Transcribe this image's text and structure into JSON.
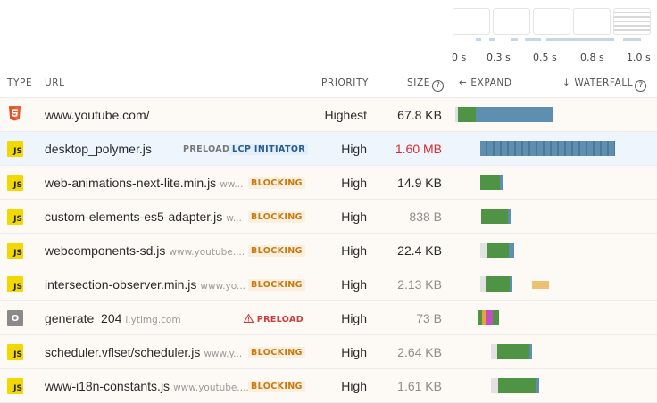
{
  "filmstrip": {
    "ticks": [
      "0 s",
      "0.3 s",
      "0.5 s",
      "0.8 s",
      "1.0 s"
    ]
  },
  "columns": {
    "type": "TYPE",
    "url": "URL",
    "priority": "PRIORITY",
    "size": "SIZE",
    "size_help": "?",
    "expand": "EXPAND",
    "expand_arrow": "←",
    "waterfall": "WATERFALL",
    "waterfall_arrow": "↓",
    "waterfall_help": "?"
  },
  "colors": {
    "js_type": "#f1d800",
    "html_type": "#e34f26",
    "blocking": "#c87a10",
    "bar_blue": "#5e8fb0",
    "bar_green": "#4f9444",
    "bar_orange": "#ecc270",
    "size_warning": "#d92c2c"
  },
  "rows": [
    {
      "type": "html",
      "type_label": "5",
      "url": "www.youtube.com/",
      "domain": "",
      "badge": "",
      "badge2": "",
      "priority": "Highest",
      "size": "67.8 KB"
    },
    {
      "type": "js",
      "type_label": "JS",
      "url": "desktop_polymer.js",
      "domain": "",
      "badge": "PRELOAD",
      "badge2": "LCP INITIATOR",
      "priority": "High",
      "size": "1.60 MB"
    },
    {
      "type": "js",
      "type_label": "JS",
      "url": "web-animations-next-lite.min.js",
      "domain": "ww...",
      "badge": "BLOCKING",
      "badge2": "",
      "priority": "High",
      "size": "14.9 KB"
    },
    {
      "type": "js",
      "type_label": "JS",
      "url": "custom-elements-es5-adapter.js",
      "domain": "w...",
      "badge": "BLOCKING",
      "badge2": "",
      "priority": "High",
      "size": "838 B"
    },
    {
      "type": "js",
      "type_label": "JS",
      "url": "webcomponents-sd.js",
      "domain": "www.youtube....",
      "badge": "BLOCKING",
      "badge2": "",
      "priority": "High",
      "size": "22.4 KB"
    },
    {
      "type": "js",
      "type_label": "JS",
      "url": "intersection-observer.min.js",
      "domain": "www.yo...",
      "badge": "BLOCKING",
      "badge2": "",
      "priority": "High",
      "size": "2.13 KB"
    },
    {
      "type": "other",
      "type_label": "O",
      "url": "generate_204",
      "domain": "i.ytimg.com",
      "badge": "PRELOAD",
      "badge2": "",
      "priority": "High",
      "size": "73 B"
    },
    {
      "type": "js",
      "type_label": "JS",
      "url": "scheduler.vflset/scheduler.js",
      "domain": "www.y...",
      "badge": "BLOCKING",
      "badge2": "",
      "priority": "High",
      "size": "2.64 KB"
    },
    {
      "type": "js",
      "type_label": "JS",
      "url": "www-i18n-constants.js",
      "domain": "www.youtube....",
      "badge": "BLOCKING",
      "badge2": "",
      "priority": "High",
      "size": "1.61 KB"
    }
  ]
}
